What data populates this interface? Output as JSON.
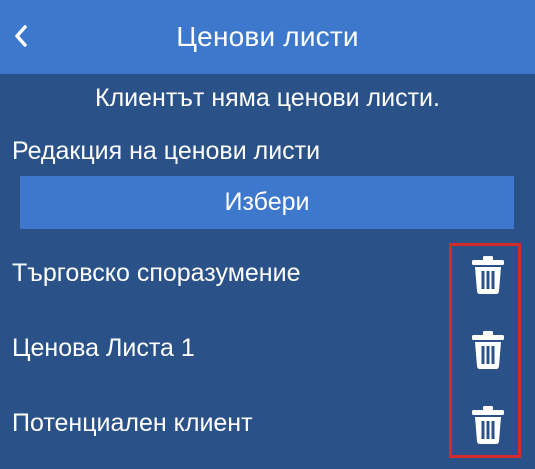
{
  "header": {
    "title": "Ценови листи",
    "back_icon": "chevron-left-icon"
  },
  "main": {
    "empty_message": "Клиентът няма ценови листи.",
    "section_label": "Редакция на ценови листи",
    "select_button_label": "Избери",
    "items": [
      {
        "label": "Търговско споразумение",
        "delete_icon": "trash-icon"
      },
      {
        "label": "Ценова Листа 1",
        "delete_icon": "trash-icon"
      },
      {
        "label": "Потенциален клиент",
        "delete_icon": "trash-icon"
      }
    ]
  },
  "colors": {
    "background": "#2b5288",
    "header": "#3e78cc",
    "button": "#3e78cc",
    "text": "#ffffff",
    "highlight": "#d42a2a"
  }
}
